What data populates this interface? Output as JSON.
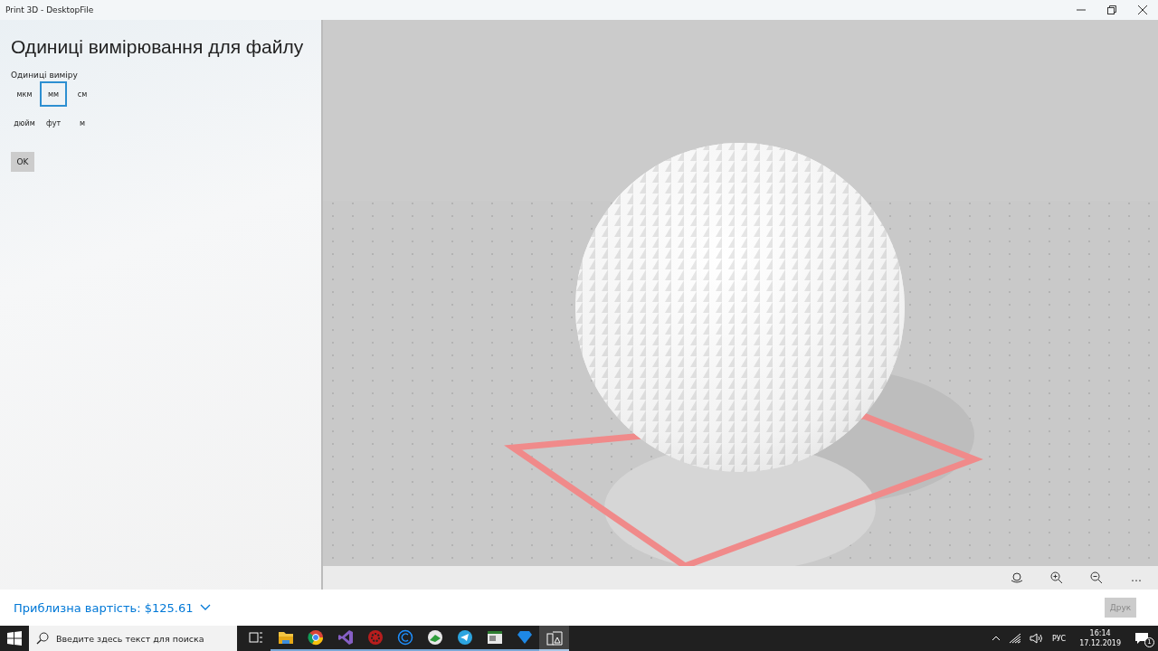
{
  "window": {
    "title": "Print 3D - DesktopFile"
  },
  "panel": {
    "heading": "Одиниці вимірювання для файлу",
    "units_label": "Одиниці виміру",
    "units": [
      {
        "label": "мкм",
        "selected": false
      },
      {
        "label": "мм",
        "selected": true
      },
      {
        "label": "см",
        "selected": false
      },
      {
        "label": "дюйм",
        "selected": false
      },
      {
        "label": "фут",
        "selected": false
      },
      {
        "label": "м",
        "selected": false
      }
    ],
    "ok_button": "OK"
  },
  "viewport_toolbar": {
    "more_button": "…"
  },
  "footer": {
    "cost": "Приблизна вартість: $125.61",
    "print_button": "Друк",
    "print_disabled": true
  },
  "taskbar": {
    "search_placeholder": "Введите здесь текст для поиска",
    "language": "РУС",
    "time": "16:14",
    "date": "17.12.2019",
    "notification_count": "1",
    "apps": [
      {
        "kind": "taskview",
        "selected": false
      },
      {
        "kind": "folder",
        "selected": false
      },
      {
        "kind": "browser",
        "selected": false
      },
      {
        "kind": "studio",
        "selected": false
      },
      {
        "kind": "gear",
        "selected": false
      },
      {
        "kind": "ring",
        "selected": false
      },
      {
        "kind": "globe",
        "selected": false
      },
      {
        "kind": "plane",
        "selected": false
      },
      {
        "kind": "window",
        "selected": false
      },
      {
        "kind": "diamond",
        "selected": false
      },
      {
        "kind": "print3d",
        "selected": true
      }
    ]
  }
}
